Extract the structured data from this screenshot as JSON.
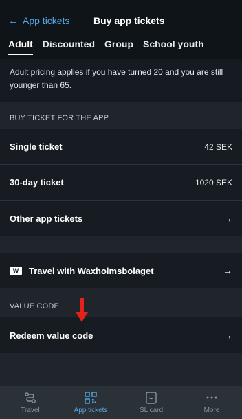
{
  "header": {
    "back_label": "App tickets",
    "title": "Buy app tickets"
  },
  "tabs": [
    {
      "label": "Adult",
      "active": true
    },
    {
      "label": "Discounted",
      "active": false
    },
    {
      "label": "Group",
      "active": false
    },
    {
      "label": "School youth",
      "active": false
    }
  ],
  "info_text": "Adult pricing applies if you have turned 20 and you are still younger than 65.",
  "buy_section": {
    "label": "BUY TICKET FOR THE APP",
    "items": [
      {
        "label": "Single ticket",
        "price": "42 SEK"
      },
      {
        "label": "30-day ticket",
        "price": "1020 SEK"
      },
      {
        "label": "Other app tickets"
      }
    ]
  },
  "waxholm": {
    "badge": "W",
    "label": "Travel with Waxholmsbolaget"
  },
  "value_code_section": {
    "label": "VALUE CODE",
    "redeem_label": "Redeem value code"
  },
  "bottom_nav": [
    {
      "label": "Travel",
      "icon": "route-icon",
      "active": false
    },
    {
      "label": "App tickets",
      "icon": "qr-code-icon",
      "active": true
    },
    {
      "label": "SL card",
      "icon": "card-icon",
      "active": false
    },
    {
      "label": "More",
      "icon": "more-icon",
      "active": false
    }
  ],
  "colors": {
    "accent": "#55a7e8",
    "background": "#1f252b",
    "marker": "#e2231a"
  }
}
